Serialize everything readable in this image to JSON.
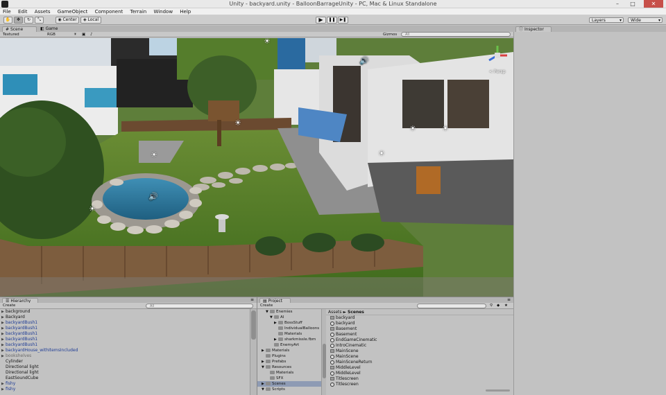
{
  "window": {
    "title": "Unity - backyard.unity - BalloonBarrageUnity - PC, Mac & Linux Standalone",
    "minimize": "–",
    "maximize": "□",
    "close": "✕"
  },
  "menu": [
    "File",
    "Edit",
    "Assets",
    "GameObject",
    "Component",
    "Terrain",
    "Window",
    "Help"
  ],
  "toolbar": {
    "pivot_mode": "Center",
    "pivot_rotation": "Local",
    "play": "▶",
    "pause": "❚❚",
    "step": "▶❚",
    "layers": "Layers",
    "layout": "Wide"
  },
  "scene_view": {
    "tab_scene": "Scene",
    "tab_game": "Game",
    "render_mode": "Textured",
    "color_mode": "RGB",
    "gizmos": "Gizmos",
    "search_placeholder": "All",
    "persp": "< Persp"
  },
  "inspector": {
    "tab": "Inspector"
  },
  "hierarchy": {
    "tab": "Hierarchy",
    "create": "Create",
    "search_placeholder": "All",
    "items": [
      {
        "label": "background",
        "arrow": "▶",
        "style": ""
      },
      {
        "label": "Backyard",
        "arrow": "▶",
        "style": ""
      },
      {
        "label": "backyardBush1",
        "arrow": "▶",
        "style": "prefab"
      },
      {
        "label": "backyardBush1",
        "arrow": "▶",
        "style": "prefab"
      },
      {
        "label": "backyardBush1",
        "arrow": "▶",
        "style": "prefab"
      },
      {
        "label": "backyardBush1",
        "arrow": "▶",
        "style": "prefab"
      },
      {
        "label": "backyardBush1",
        "arrow": "▶",
        "style": "prefab"
      },
      {
        "label": "backyardHouse_withItemsIncluded",
        "arrow": "▶",
        "style": "prefab"
      },
      {
        "label": "bookshelves",
        "arrow": "▶",
        "style": "grey"
      },
      {
        "label": "Cylinder",
        "arrow": "",
        "style": ""
      },
      {
        "label": "Directional light",
        "arrow": "",
        "style": ""
      },
      {
        "label": "Directional light",
        "arrow": "",
        "style": ""
      },
      {
        "label": "EastSoundCube",
        "arrow": "",
        "style": ""
      },
      {
        "label": "fishy",
        "arrow": "▶",
        "style": "prefab"
      },
      {
        "label": "fishy",
        "arrow": "▶",
        "style": "prefab"
      }
    ]
  },
  "project": {
    "tab": "Project",
    "create": "Create",
    "search_placeholder": "",
    "breadcrumb_root": "Assets",
    "breadcrumb_sep": "►",
    "breadcrumb_current": "Scenes",
    "tree": [
      {
        "label": "Enemies",
        "indent": 2,
        "arrow": "▼",
        "selected": false
      },
      {
        "label": "AI",
        "indent": 3,
        "arrow": "▼",
        "selected": false
      },
      {
        "label": "BossStuff",
        "indent": 4,
        "arrow": "▶",
        "selected": false
      },
      {
        "label": "IndividualBalloons",
        "indent": 4,
        "arrow": "",
        "selected": false
      },
      {
        "label": "Materials",
        "indent": 4,
        "arrow": "",
        "selected": false
      },
      {
        "label": "sharkmissle.fbm",
        "indent": 4,
        "arrow": "▶",
        "selected": false
      },
      {
        "label": "EnemyArt",
        "indent": 3,
        "arrow": "",
        "selected": false
      },
      {
        "label": "Materials",
        "indent": 1,
        "arrow": "▶",
        "selected": false
      },
      {
        "label": "Plugins",
        "indent": 1,
        "arrow": "",
        "selected": false
      },
      {
        "label": "Prefabs",
        "indent": 1,
        "arrow": "▶",
        "selected": false
      },
      {
        "label": "Resources",
        "indent": 1,
        "arrow": "▼",
        "selected": false
      },
      {
        "label": "Materials",
        "indent": 2,
        "arrow": "",
        "selected": false
      },
      {
        "label": "SFX",
        "indent": 2,
        "arrow": "",
        "selected": false
      },
      {
        "label": "Scenes",
        "indent": 1,
        "arrow": "▶",
        "selected": true
      },
      {
        "label": "Scripts",
        "indent": 1,
        "arrow": "▼",
        "selected": false
      }
    ],
    "assets": [
      {
        "label": "backyard",
        "icon": "box"
      },
      {
        "label": "backyard",
        "icon": "scene"
      },
      {
        "label": "Basement",
        "icon": "box"
      },
      {
        "label": "Basement",
        "icon": "scene"
      },
      {
        "label": "EndGameCinematic",
        "icon": "scene"
      },
      {
        "label": "IntroCinematic",
        "icon": "scene"
      },
      {
        "label": "MainScene",
        "icon": "box"
      },
      {
        "label": "MainScene",
        "icon": "scene"
      },
      {
        "label": "MainSceneReturn",
        "icon": "scene"
      },
      {
        "label": "MiddleLevel",
        "icon": "box"
      },
      {
        "label": "MiddleLevel",
        "icon": "scene"
      },
      {
        "label": "Titlescreen",
        "icon": "box"
      },
      {
        "label": "Titlescreen",
        "icon": "scene"
      }
    ]
  }
}
